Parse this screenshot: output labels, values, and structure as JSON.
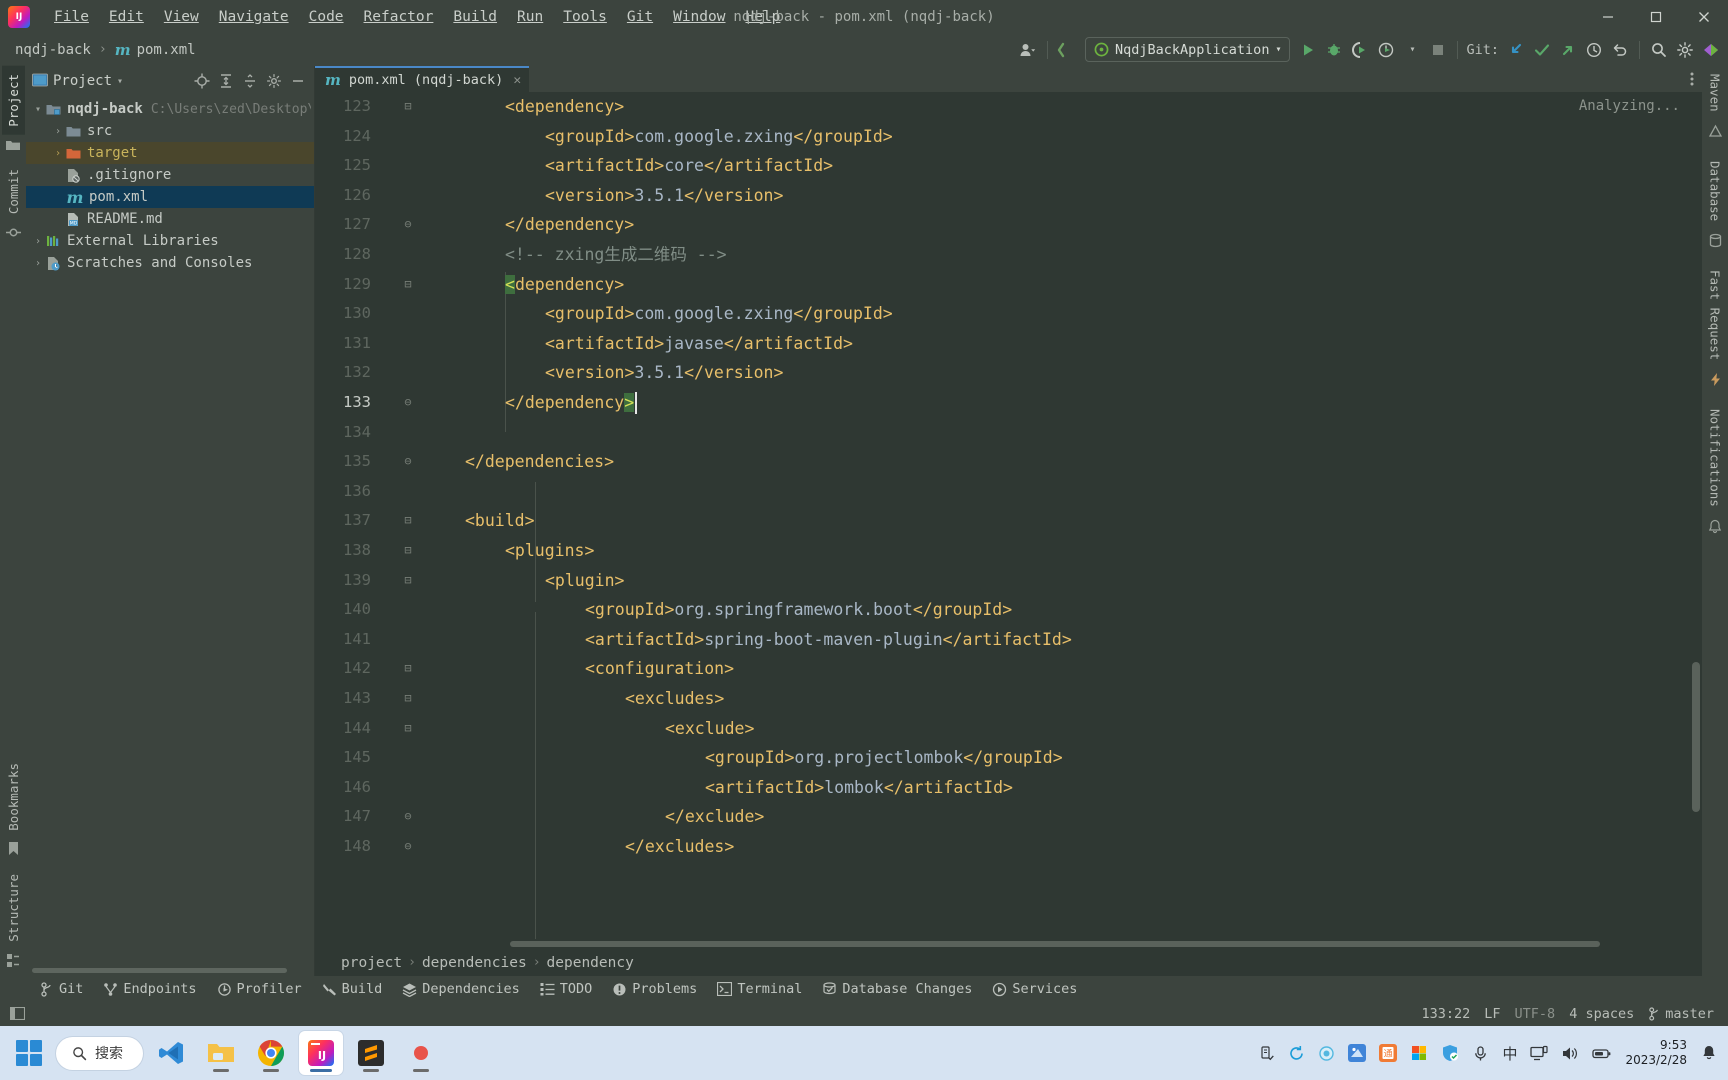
{
  "window": {
    "title": "nqdj-back - pom.xml (nqdj-back)",
    "minimize": "–",
    "maximize": "▭",
    "close": "✕"
  },
  "menu": [
    {
      "label": "File"
    },
    {
      "label": "Edit"
    },
    {
      "label": "View"
    },
    {
      "label": "Navigate"
    },
    {
      "label": "Code"
    },
    {
      "label": "Refactor"
    },
    {
      "label": "Build"
    },
    {
      "label": "Run"
    },
    {
      "label": "Tools"
    },
    {
      "label": "Git"
    },
    {
      "label": "Window"
    },
    {
      "label": "Help"
    }
  ],
  "navbar": {
    "crumbs": [
      "nqdj-back",
      "pom.xml"
    ],
    "separator": "›",
    "run_config": "NqdjBackApplication",
    "run_config_caret": "▾",
    "git_label": "Git:",
    "icons": {
      "account": "account-icon",
      "updates": "update-project-icon",
      "run": "run-icon",
      "debug": "debug-icon",
      "run_coverage": "run-with-coverage-icon",
      "profiler": "profiler-icon",
      "stop": "stop-icon",
      "git_update": "git-update-icon",
      "git_commit": "git-commit-icon",
      "git_push": "git-push-icon",
      "git_history": "git-history-icon",
      "undo": "undo-icon",
      "search": "search-everywhere-icon",
      "settings": "settings-icon",
      "plugin": "plugin-icon"
    }
  },
  "left_stripe": {
    "tabs": [
      {
        "label": "Project",
        "icon": "project-icon",
        "active": true
      },
      {
        "label": "Commit",
        "icon": "commit-icon",
        "active": false
      }
    ],
    "bottom_tabs": [
      {
        "label": "Bookmarks",
        "icon": "bookmarks-icon"
      },
      {
        "label": "Structure",
        "icon": "structure-icon"
      }
    ]
  },
  "right_stripe": {
    "tabs": [
      {
        "label": "Maven",
        "icon": "maven-icon"
      },
      {
        "label": "Database",
        "icon": "database-icon"
      },
      {
        "label": "Fast Request",
        "icon": "fast-request-icon"
      },
      {
        "label": "Notifications",
        "icon": "notifications-icon"
      }
    ]
  },
  "project_panel": {
    "title": "Project",
    "title_caret": "▾",
    "toolbar_icons": [
      "locate-icon",
      "expand-all-icon",
      "collapse-all-icon",
      "gear-icon",
      "hide-icon"
    ],
    "tree": [
      {
        "depth": 0,
        "arrow": "▾",
        "icon": "module-folder-icon",
        "label": "nqdj-back",
        "bold": true,
        "path": "C:\\Users\\zed\\Desktop\\n",
        "state": "normal"
      },
      {
        "depth": 1,
        "arrow": "›",
        "icon": "folder-icon",
        "label": "src",
        "path": "",
        "state": "normal"
      },
      {
        "depth": 1,
        "arrow": "›",
        "icon": "excluded-folder-icon",
        "label": "target",
        "path": "",
        "state": "highlight"
      },
      {
        "depth": 1,
        "arrow": "",
        "icon": "gitignore-file-icon",
        "label": ".gitignore",
        "path": "",
        "state": "normal"
      },
      {
        "depth": 1,
        "arrow": "",
        "icon": "maven-file-icon",
        "label": "pom.xml",
        "path": "",
        "state": "selected"
      },
      {
        "depth": 1,
        "arrow": "",
        "icon": "markdown-file-icon",
        "label": "README.md",
        "path": "",
        "state": "normal"
      },
      {
        "depth": 0,
        "arrow": "›",
        "icon": "libraries-icon",
        "label": "External Libraries",
        "path": "",
        "state": "normal"
      },
      {
        "depth": 0,
        "arrow": "›",
        "icon": "scratches-icon",
        "label": "Scratches and Consoles",
        "path": "",
        "state": "normal"
      }
    ]
  },
  "editor": {
    "tab": {
      "label": "pom.xml (nqdj-back)",
      "icon": "maven-file-icon",
      "close": "✕"
    },
    "tabs_options_icon": "more-options-icon",
    "status_hint": "Analyzing...",
    "first_line_number": 123,
    "current_line": 133,
    "lines": [
      {
        "n": 123,
        "fold": "⊟",
        "indent": 2,
        "segments": [
          {
            "t": "<dependency>",
            "c": "tag"
          }
        ]
      },
      {
        "n": 124,
        "fold": "",
        "indent": 3,
        "segments": [
          {
            "t": "<groupId>",
            "c": "tag"
          },
          {
            "t": "com.google.zxing",
            "c": "text"
          },
          {
            "t": "</groupId>",
            "c": "tag"
          }
        ]
      },
      {
        "n": 125,
        "fold": "",
        "indent": 3,
        "segments": [
          {
            "t": "<artifactId>",
            "c": "tag"
          },
          {
            "t": "core",
            "c": "text"
          },
          {
            "t": "</artifactId>",
            "c": "tag"
          }
        ]
      },
      {
        "n": 126,
        "fold": "",
        "indent": 3,
        "segments": [
          {
            "t": "<version>",
            "c": "tag"
          },
          {
            "t": "3.5.1",
            "c": "text"
          },
          {
            "t": "</version>",
            "c": "tag"
          }
        ]
      },
      {
        "n": 127,
        "fold": "⊖",
        "indent": 2,
        "segments": [
          {
            "t": "</dependency>",
            "c": "tag"
          }
        ]
      },
      {
        "n": 128,
        "fold": "",
        "indent": 2,
        "segments": [
          {
            "t": "<!-- zxing生成二维码 -->",
            "c": "comment"
          }
        ]
      },
      {
        "n": 129,
        "fold": "⊟",
        "indent": 2,
        "segments": [
          {
            "t": "<",
            "c": "match"
          },
          {
            "t": "dependency>",
            "c": "tag"
          }
        ]
      },
      {
        "n": 130,
        "fold": "",
        "indent": 3,
        "segments": [
          {
            "t": "<groupId>",
            "c": "tag"
          },
          {
            "t": "com.google.zxing",
            "c": "text"
          },
          {
            "t": "</groupId>",
            "c": "tag"
          }
        ]
      },
      {
        "n": 131,
        "fold": "",
        "indent": 3,
        "segments": [
          {
            "t": "<artifactId>",
            "c": "tag"
          },
          {
            "t": "javase",
            "c": "text"
          },
          {
            "t": "</artifactId>",
            "c": "tag"
          }
        ]
      },
      {
        "n": 132,
        "fold": "",
        "indent": 3,
        "segments": [
          {
            "t": "<version>",
            "c": "tag"
          },
          {
            "t": "3.5.1",
            "c": "text"
          },
          {
            "t": "</version>",
            "c": "tag"
          }
        ]
      },
      {
        "n": 133,
        "fold": "⊖",
        "indent": 2,
        "segments": [
          {
            "t": "</dependency",
            "c": "tag"
          },
          {
            "t": ">",
            "c": "match"
          }
        ]
      },
      {
        "n": 134,
        "fold": "",
        "indent": 0,
        "segments": []
      },
      {
        "n": 135,
        "fold": "⊖",
        "indent": 1,
        "segments": [
          {
            "t": "</dependencies>",
            "c": "tag"
          }
        ]
      },
      {
        "n": 136,
        "fold": "",
        "indent": 0,
        "segments": []
      },
      {
        "n": 137,
        "fold": "⊟",
        "indent": 1,
        "segments": [
          {
            "t": "<build>",
            "c": "tag"
          }
        ]
      },
      {
        "n": 138,
        "fold": "⊟",
        "indent": 2,
        "segments": [
          {
            "t": "<plugins>",
            "c": "tag"
          }
        ]
      },
      {
        "n": 139,
        "fold": "⊟",
        "indent": 3,
        "segments": [
          {
            "t": "<plugin>",
            "c": "tag"
          }
        ]
      },
      {
        "n": 140,
        "fold": "",
        "indent": 4,
        "segments": [
          {
            "t": "<groupId>",
            "c": "tag"
          },
          {
            "t": "org.springframework.boot",
            "c": "text"
          },
          {
            "t": "</groupId>",
            "c": "tag"
          }
        ]
      },
      {
        "n": 141,
        "fold": "",
        "indent": 4,
        "segments": [
          {
            "t": "<artifactId>",
            "c": "tag"
          },
          {
            "t": "spring-boot-maven-plugin",
            "c": "text"
          },
          {
            "t": "</artifactId>",
            "c": "tag"
          }
        ]
      },
      {
        "n": 142,
        "fold": "⊟",
        "indent": 4,
        "segments": [
          {
            "t": "<configuration>",
            "c": "tag"
          }
        ]
      },
      {
        "n": 143,
        "fold": "⊟",
        "indent": 5,
        "segments": [
          {
            "t": "<excludes>",
            "c": "tag"
          }
        ]
      },
      {
        "n": 144,
        "fold": "⊟",
        "indent": 6,
        "segments": [
          {
            "t": "<exclude>",
            "c": "tag"
          }
        ]
      },
      {
        "n": 145,
        "fold": "",
        "indent": 7,
        "segments": [
          {
            "t": "<groupId>",
            "c": "tag"
          },
          {
            "t": "org.projectlombok",
            "c": "text"
          },
          {
            "t": "</groupId>",
            "c": "tag"
          }
        ]
      },
      {
        "n": 146,
        "fold": "",
        "indent": 7,
        "segments": [
          {
            "t": "<artifactId>",
            "c": "tag"
          },
          {
            "t": "lombok",
            "c": "text"
          },
          {
            "t": "</artifactId>",
            "c": "tag"
          }
        ]
      },
      {
        "n": 147,
        "fold": "⊖",
        "indent": 6,
        "segments": [
          {
            "t": "</exclude>",
            "c": "tag"
          }
        ]
      },
      {
        "n": 148,
        "fold": "⊖",
        "indent": 5,
        "segments": [
          {
            "t": "</excludes>",
            "c": "tag"
          }
        ]
      }
    ],
    "breadcrumbs": [
      "project",
      "dependencies",
      "dependency"
    ],
    "breadcrumb_sep": "›"
  },
  "bottom_tools": [
    {
      "label": "Git",
      "icon": "git-branch-icon"
    },
    {
      "label": "Endpoints",
      "icon": "endpoints-icon"
    },
    {
      "label": "Profiler",
      "icon": "profiler-icon"
    },
    {
      "label": "Build",
      "icon": "build-hammer-icon"
    },
    {
      "label": "Dependencies",
      "icon": "dependencies-icon"
    },
    {
      "label": "TODO",
      "icon": "todo-icon"
    },
    {
      "label": "Problems",
      "icon": "problems-icon"
    },
    {
      "label": "Terminal",
      "icon": "terminal-icon"
    },
    {
      "label": "Database Changes",
      "icon": "database-changes-icon"
    },
    {
      "label": "Services",
      "icon": "services-icon"
    }
  ],
  "status_bar": {
    "left_icon": "toggle-toolwindows-icon",
    "caret_position": "133:22",
    "line_separator": "LF",
    "encoding": "UTF-8",
    "indent": "4 spaces",
    "branch_icon": "git-branch-icon",
    "branch": "master"
  },
  "taskbar": {
    "start_icon": "windows-start-icon",
    "search_placeholder": "搜索",
    "search_icon": "search-icon",
    "apps": [
      {
        "name": "vscode",
        "active": false,
        "running": false
      },
      {
        "name": "file-explorer",
        "active": false,
        "running": true
      },
      {
        "name": "chrome",
        "active": false,
        "running": true
      },
      {
        "name": "intellij-idea",
        "active": true,
        "running": true
      },
      {
        "name": "sublime-text",
        "active": false,
        "running": true
      },
      {
        "name": "app-extra",
        "active": false,
        "running": true
      }
    ],
    "tray_icons": [
      "usb-eject-icon",
      "sync-icon",
      "circle-icon",
      "onedrive-icon",
      "tongwen-icon",
      "windows-store-icon",
      "security-shield-icon",
      "microphone-icon",
      "ime-chinese-icon",
      "display-icon",
      "volume-icon",
      "battery-icon"
    ],
    "ime_label": "中",
    "time": "9:53",
    "date": "2023/2/28",
    "notification_icon": "notifications-bell-icon"
  }
}
